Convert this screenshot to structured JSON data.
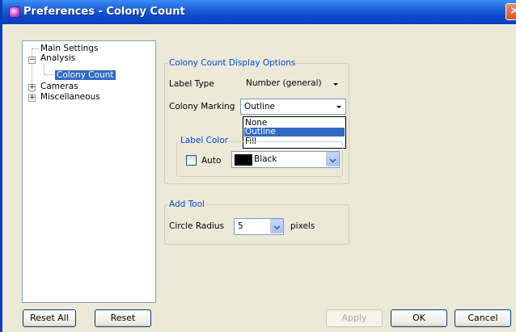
{
  "window": {
    "title": "Preferences - Colony Count",
    "close_glyph": "✕"
  },
  "tree": {
    "items": [
      {
        "label": "Main Settings",
        "expander": ""
      },
      {
        "label": "Analysis",
        "expander": "−"
      },
      {
        "label": "Colony Count",
        "expander": "",
        "selected": true
      },
      {
        "label": "Cameras",
        "expander": "+"
      },
      {
        "label": "Miscellaneous",
        "expander": "+"
      }
    ]
  },
  "display_options": {
    "group_title": "Colony Count Display Options",
    "label_type": {
      "label": "Label Type",
      "value": "Number (general)"
    },
    "colony_marking": {
      "label": "Colony Marking",
      "value": "Outline"
    },
    "marking_options": [
      "None",
      "Outline",
      "Fill"
    ],
    "marking_selected_index": 1,
    "label_color": {
      "group_title": "Label Color",
      "auto_label": "Auto",
      "auto_checked": false,
      "color_value": "Black",
      "color_hex": "#000000"
    }
  },
  "add_tool": {
    "group_title": "Add Tool",
    "circle_radius": {
      "label": "Circle Radius",
      "value": "5",
      "unit": "pixels"
    }
  },
  "buttons": {
    "reset_all": "Reset All",
    "reset": "Reset",
    "apply": "Apply",
    "ok": "OK",
    "cancel": "Cancel"
  },
  "colors": {
    "titlebar": "#0a3fb8",
    "selection": "#316ac5",
    "group_title": "#0046d5",
    "dialog_bg": "#ece9d8"
  }
}
